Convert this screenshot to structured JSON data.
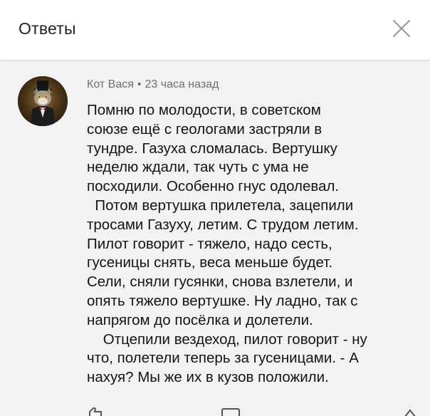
{
  "header": {
    "title": "Ответы",
    "close_icon": "close-icon"
  },
  "comment": {
    "author": "Кот Вася",
    "separator": "•",
    "time": "23 часа назад",
    "avatar_icon": "cat-avatar",
    "lines": [
      "Помню по молодости, в советском",
      "союзе ещё с геологами застряли в",
      "тундре. Газуха сломалась. Вертушку",
      "неделю ждали, так чуть с ума не",
      "посходили. Особенно гнус одолевал.",
      "  Потом вертушка прилетела, зацепили",
      "тросами Газуху, летим. С трудом летим.",
      "Пилот говорит - тяжело, надо сесть,",
      "гусеницы снять, веса меньше будет.",
      "Сели, сняли гусянки, снова взлетели, и",
      "опять тяжело вертушке. Ну ладно, так с",
      "напрягом до посёлка и долетели.",
      "    Отцепили вездеход, пилот говорит - ну",
      "что, полетели теперь за гусеницами. - А",
      "нахуя? Мы же их в кузов положили."
    ]
  },
  "actions": {
    "icons": [
      "like-icon",
      "reply-icon",
      "share-icon"
    ]
  },
  "colors": {
    "header_bg": "#ffffff",
    "page_bg": "#f2f2f2",
    "meta_text": "#6e6e6e",
    "body_text": "#141414"
  }
}
